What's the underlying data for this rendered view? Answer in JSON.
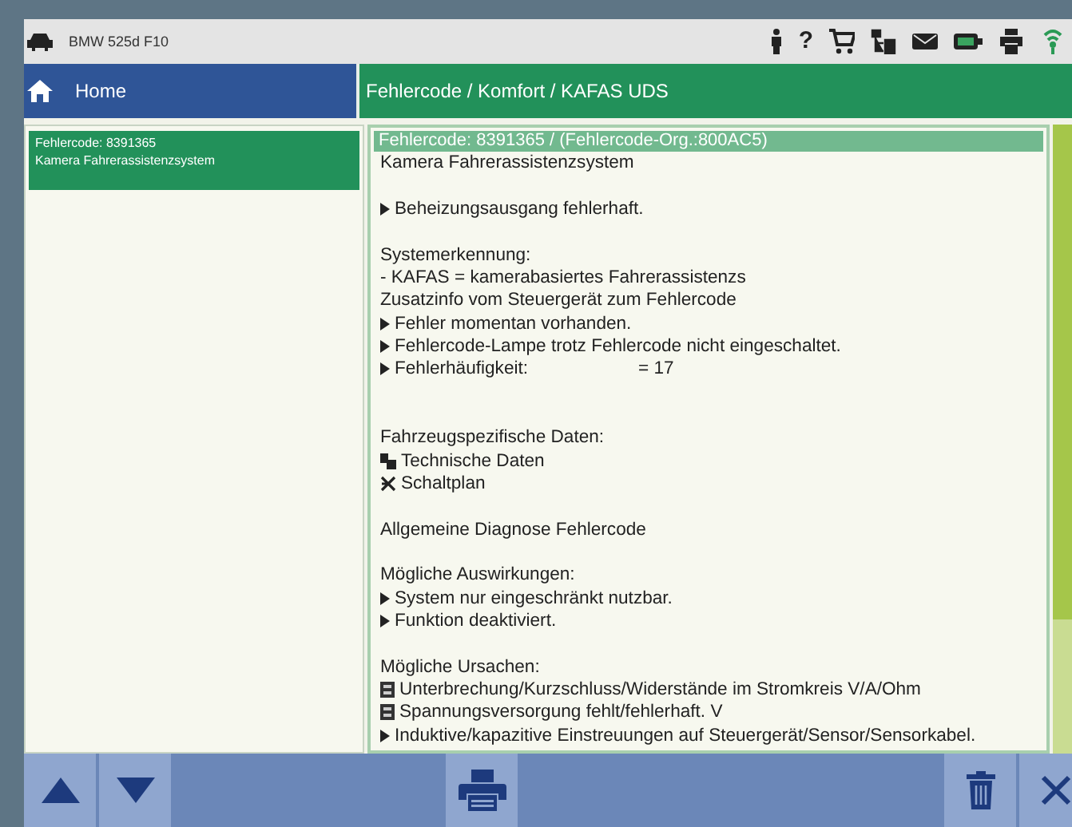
{
  "vehicle": "BMW 525d F10",
  "toolbar": {
    "help": "?"
  },
  "nav": {
    "home": "Home",
    "breadcrumb": "Fehlercode / Komfort / KAFAS UDS"
  },
  "fault_list": [
    {
      "code": "Fehlercode: 8391365",
      "name": "Kamera Fahrerassistenzsystem",
      "selected": true
    }
  ],
  "detail": {
    "header": "Fehlercode: 8391365 / (Fehlercode-Org.:800AC5)",
    "lines": [
      {
        "kind": "plain",
        "text": "Kamera Fahrerassistenzsystem"
      },
      {
        "kind": "blank"
      },
      {
        "kind": "bullet",
        "text": "Beheizungsausgang fehlerhaft."
      },
      {
        "kind": "blank"
      },
      {
        "kind": "plain",
        "text": "Systemerkennung:"
      },
      {
        "kind": "plain",
        "text": "- KAFAS = kamerabasiertes Fahrerassistenzs"
      },
      {
        "kind": "plain",
        "text": "Zusatzinfo vom Steuergerät zum Fehlercode"
      },
      {
        "kind": "bullet",
        "text": "Fehler momentan vorhanden."
      },
      {
        "kind": "bullet",
        "text": "Fehlercode-Lampe trotz Fehlercode nicht eingeschaltet."
      },
      {
        "kind": "bullet",
        "text": "Fehlerhäufigkeit:",
        "value": "= 17"
      },
      {
        "kind": "blank"
      },
      {
        "kind": "blank"
      },
      {
        "kind": "plain",
        "text": "Fahrzeugspezifische Daten:"
      },
      {
        "kind": "data-link",
        "text": "Technische Daten"
      },
      {
        "kind": "wiring-link",
        "text": "Schaltplan"
      },
      {
        "kind": "blank"
      },
      {
        "kind": "plain",
        "text": "Allgemeine Diagnose Fehlercode"
      },
      {
        "kind": "blank"
      },
      {
        "kind": "plain",
        "text": "Mögliche Auswirkungen:"
      },
      {
        "kind": "bullet",
        "text": "System nur eingeschränkt nutzbar."
      },
      {
        "kind": "bullet",
        "text": "Funktion deaktiviert."
      },
      {
        "kind": "blank"
      },
      {
        "kind": "plain",
        "text": "Mögliche Ursachen:"
      },
      {
        "kind": "test-link",
        "text": "Unterbrechung/Kurzschluss/Widerstände im Stromkreis V/A/Ohm"
      },
      {
        "kind": "test-link",
        "text": "Spannungsversorgung fehlt/fehlerhaft. V"
      },
      {
        "kind": "bullet",
        "text": "Induktive/kapazitive Einstreuungen auf Steuergerät/Sensor/Sensorkabel."
      }
    ]
  }
}
